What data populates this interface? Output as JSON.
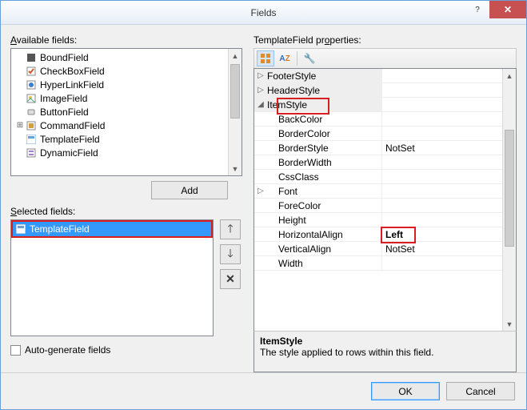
{
  "window": {
    "title": "Fields"
  },
  "left": {
    "available_label": "Available fields:",
    "selected_label": "Selected fields:",
    "add_label": "Add",
    "autogen_label": "Auto-generate fields",
    "available": [
      {
        "label": "BoundField",
        "expander": ""
      },
      {
        "label": "CheckBoxField",
        "expander": ""
      },
      {
        "label": "HyperLinkField",
        "expander": ""
      },
      {
        "label": "ImageField",
        "expander": ""
      },
      {
        "label": "ButtonField",
        "expander": ""
      },
      {
        "label": "CommandField",
        "expander": "+"
      },
      {
        "label": "TemplateField",
        "expander": ""
      },
      {
        "label": "DynamicField",
        "expander": ""
      }
    ],
    "selected": [
      {
        "label": "TemplateField"
      }
    ]
  },
  "right": {
    "prop_label": "TemplateField properties:",
    "rows": [
      {
        "kind": "cat",
        "exp": "▷",
        "indent": 0,
        "name": "FooterStyle",
        "value": ""
      },
      {
        "kind": "cat",
        "exp": "▷",
        "indent": 0,
        "name": "HeaderStyle",
        "value": ""
      },
      {
        "kind": "cat",
        "exp": "◢",
        "indent": 0,
        "name": "ItemStyle",
        "value": "",
        "hl": "itemstyle"
      },
      {
        "kind": "prop",
        "indent": 1,
        "name": "BackColor",
        "value": ""
      },
      {
        "kind": "prop",
        "indent": 1,
        "name": "BorderColor",
        "value": ""
      },
      {
        "kind": "prop",
        "indent": 1,
        "name": "BorderStyle",
        "value": "NotSet"
      },
      {
        "kind": "prop",
        "indent": 1,
        "name": "BorderWidth",
        "value": ""
      },
      {
        "kind": "prop",
        "indent": 1,
        "name": "CssClass",
        "value": ""
      },
      {
        "kind": "cat",
        "exp": "▷",
        "indent": 1,
        "name": "Font",
        "value": ""
      },
      {
        "kind": "prop",
        "indent": 1,
        "name": "ForeColor",
        "value": ""
      },
      {
        "kind": "prop",
        "indent": 1,
        "name": "Height",
        "value": ""
      },
      {
        "kind": "prop",
        "indent": 1,
        "name": "HorizontalAlign",
        "value": "Left",
        "bold": true,
        "hl": "left"
      },
      {
        "kind": "prop",
        "indent": 1,
        "name": "VerticalAlign",
        "value": "NotSet"
      },
      {
        "kind": "prop",
        "indent": 1,
        "name": "Width",
        "value": ""
      }
    ],
    "desc": {
      "title": "ItemStyle",
      "text": "The style applied to rows within this field."
    }
  },
  "footer": {
    "ok": "OK",
    "cancel": "Cancel"
  }
}
